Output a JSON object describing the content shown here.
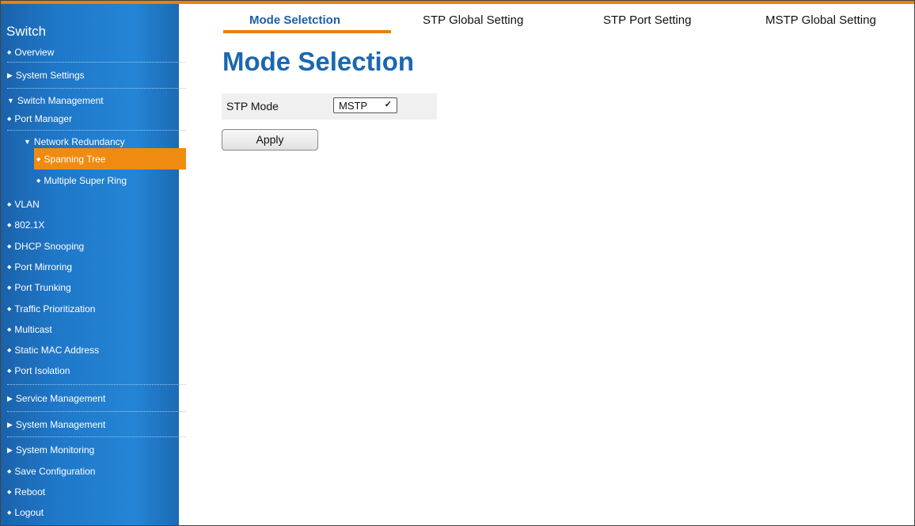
{
  "sidebar": {
    "brand": "Switch",
    "items": [
      {
        "label": "Overview",
        "marker": "bullet"
      },
      {
        "label": "System Settings",
        "marker": "triangle-right"
      },
      {
        "label": "Switch Management",
        "marker": "triangle-down"
      },
      {
        "label": "Port Manager",
        "marker": "bullet"
      },
      {
        "label": "Network Redundancy",
        "marker": "triangle-down"
      },
      {
        "label": "Spanning Tree",
        "marker": "bullet",
        "selected": true
      },
      {
        "label": "Multiple Super Ring",
        "marker": "bullet"
      },
      {
        "label": "VLAN",
        "marker": "bullet"
      },
      {
        "label": "802.1X",
        "marker": "bullet"
      },
      {
        "label": "DHCP Snooping",
        "marker": "bullet"
      },
      {
        "label": "Port Mirroring",
        "marker": "bullet"
      },
      {
        "label": "Port Trunking",
        "marker": "bullet"
      },
      {
        "label": "Traffic Prioritization",
        "marker": "bullet"
      },
      {
        "label": "Multicast",
        "marker": "bullet"
      },
      {
        "label": "Static MAC Address",
        "marker": "bullet"
      },
      {
        "label": "Port Isolation",
        "marker": "bullet"
      },
      {
        "label": "Service Management",
        "marker": "triangle-right"
      },
      {
        "label": "System Management",
        "marker": "triangle-right"
      },
      {
        "label": "System Monitoring",
        "marker": "triangle-right"
      },
      {
        "label": "Save Configuration",
        "marker": "bullet"
      },
      {
        "label": "Reboot",
        "marker": "bullet"
      },
      {
        "label": "Logout",
        "marker": "bullet"
      }
    ]
  },
  "tabs": [
    {
      "label": "Mode Seletction",
      "active": true
    },
    {
      "label": "STP Global Setting"
    },
    {
      "label": "STP Port Setting"
    },
    {
      "label": "MSTP Global Setting"
    }
  ],
  "main": {
    "title": "Mode Selection",
    "stp_mode_label": "STP Mode",
    "stp_mode_value": "MSTP",
    "apply_label": "Apply"
  },
  "colors": {
    "accent": "#e8820b",
    "sidebar_blue": "#1f77c8",
    "title_blue": "#1b67b0"
  }
}
